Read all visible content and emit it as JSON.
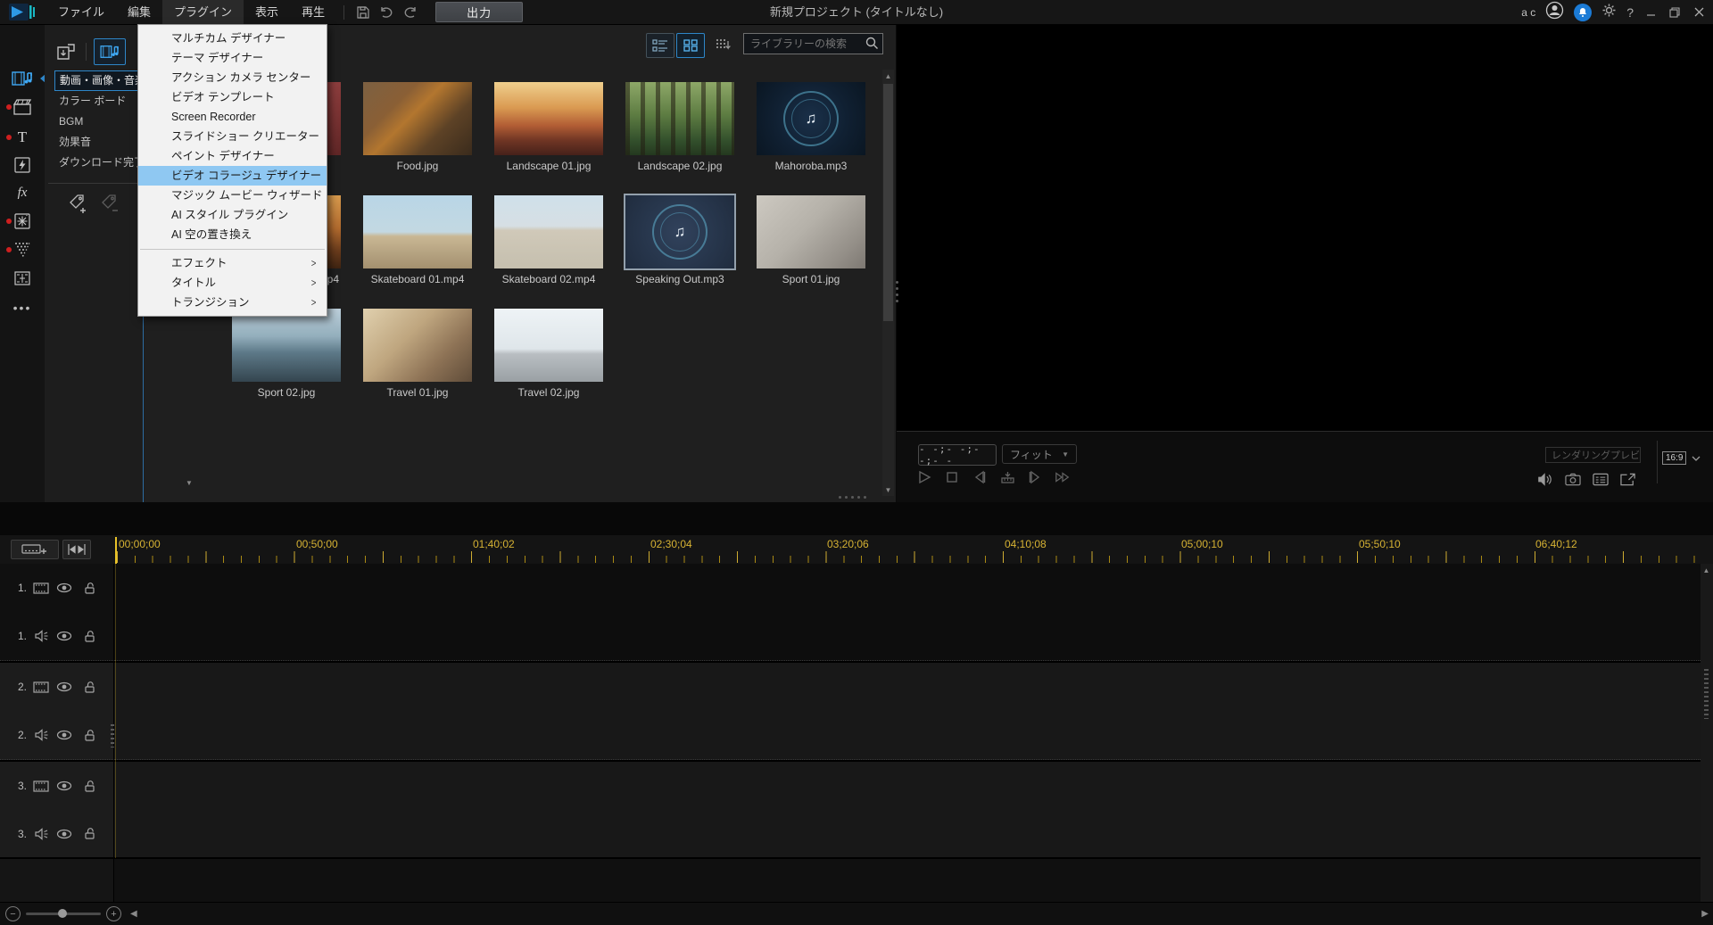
{
  "titlebar": {
    "menus": [
      "ファイル",
      "編集",
      "プラグイン",
      "表示",
      "再生"
    ],
    "output_button": "出力",
    "project_title": "新規プロジェクト (タイトルなし)",
    "account": "a c",
    "help_label": "?"
  },
  "plugin_menu": {
    "items": [
      "マルチカム デザイナー",
      "テーマ デザイナー",
      "アクション カメラ センター",
      "ビデオ テンプレート",
      "Screen Recorder",
      "スライドショー クリエーター",
      "ペイント デザイナー",
      "ビデオ コラージュ デザイナー",
      "マジック ムービー ウィザード",
      "AI スタイル プラグイン",
      "AI 空の置き換え"
    ],
    "highlighted_item": "ビデオ コラージュ デザイナー",
    "submenu_items": [
      "エフェクト",
      "タイトル",
      "トランジション"
    ]
  },
  "sidebar": {
    "icons": [
      "media-room-icon",
      "templates-icon",
      "titles-icon",
      "transitions-icon",
      "effects-fx-icon",
      "particles-icon",
      "particle-spray-icon",
      "subtitle-icon",
      "more-icon"
    ]
  },
  "media_panel": {
    "categories": [
      "動画・画像・音楽",
      "カラー ボード",
      "BGM",
      "効果音",
      "ダウンロード完了"
    ],
    "selected_category": "動画・画像・音楽"
  },
  "library": {
    "search_placeholder": "ライブラリーの検索",
    "items": [
      {
        "label": "",
        "kind": "image"
      },
      {
        "label": "Food.jpg",
        "kind": "image"
      },
      {
        "label": "Landscape 01.jpg",
        "kind": "image"
      },
      {
        "label": "Landscape 02.jpg",
        "kind": "image"
      },
      {
        "label": "Mahoroba.mp3",
        "kind": "audio"
      },
      {
        "label": "p4",
        "kind": "video"
      },
      {
        "label": "Skateboard 01.mp4",
        "kind": "video"
      },
      {
        "label": "Skateboard 02.mp4",
        "kind": "video"
      },
      {
        "label": "Speaking Out.mp3",
        "kind": "audio",
        "selected": true
      },
      {
        "label": "Sport 01.jpg",
        "kind": "image"
      },
      {
        "label": "Sport 02.jpg",
        "kind": "image"
      },
      {
        "label": "Travel 01.jpg",
        "kind": "image"
      },
      {
        "label": "Travel 02.jpg",
        "kind": "image"
      }
    ]
  },
  "preview": {
    "timecode": "- -;- -;- -;- -",
    "zoom_mode": "フィット",
    "render_preview_label": "レンダリングプレビ...",
    "aspect_ratio": "16:9"
  },
  "timeline": {
    "ruler_labels": [
      "00;00;00",
      "00;50;00",
      "01;40;02",
      "02;30;04",
      "03;20;06",
      "04;10;08",
      "05;00;10",
      "05;50;10",
      "06;40;12"
    ],
    "tracks": [
      {
        "number": "1.",
        "type": "video"
      },
      {
        "number": "1.",
        "type": "audio"
      },
      {
        "number": "2.",
        "type": "video"
      },
      {
        "number": "2.",
        "type": "audio"
      },
      {
        "number": "3.",
        "type": "video"
      },
      {
        "number": "3.",
        "type": "audio"
      }
    ]
  }
}
